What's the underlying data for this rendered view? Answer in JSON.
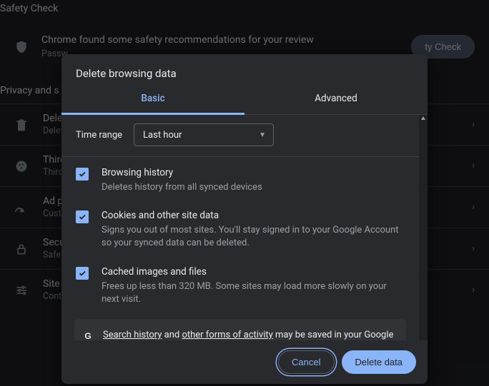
{
  "bg": {
    "safety_check_header": "Safety Check",
    "safety_title": "Chrome found some safety recommendations for your review",
    "safety_sub": "Passw",
    "safety_btn": "ty Check",
    "privacy_header": "Privacy and s",
    "rows": [
      {
        "title": "Delet",
        "sub": "Delet"
      },
      {
        "title": "Third",
        "sub": "Third"
      },
      {
        "title": "Ad p",
        "sub": "Custo"
      },
      {
        "title": "Secu",
        "sub": "Safe "
      },
      {
        "title": "Site s",
        "sub": "Cont"
      }
    ]
  },
  "dialog": {
    "title": "Delete browsing data",
    "tabs": {
      "basic": "Basic",
      "advanced": "Advanced"
    },
    "time_range_label": "Time range",
    "time_range_value": "Last hour",
    "options": [
      {
        "checked": true,
        "title": "Browsing history",
        "desc": "Deletes history from all synced devices"
      },
      {
        "checked": true,
        "title": "Cookies and other site data",
        "desc": "Signs you out of most sites. You'll stay signed in to your Google Account so your synced data can be deleted."
      },
      {
        "checked": true,
        "title": "Cached images and files",
        "desc": "Frees up less than 320 MB. Some sites may load more slowly on your next visit."
      }
    ],
    "notice": {
      "link1": "Search history",
      "mid1": " and ",
      "link2": "other forms of activity",
      "rest": " may be saved in your Google Account when you're signed in. You can delete them anytime."
    },
    "cancel": "Cancel",
    "delete": "Delete data"
  },
  "colors": {
    "accent": "#8ab4f8"
  }
}
